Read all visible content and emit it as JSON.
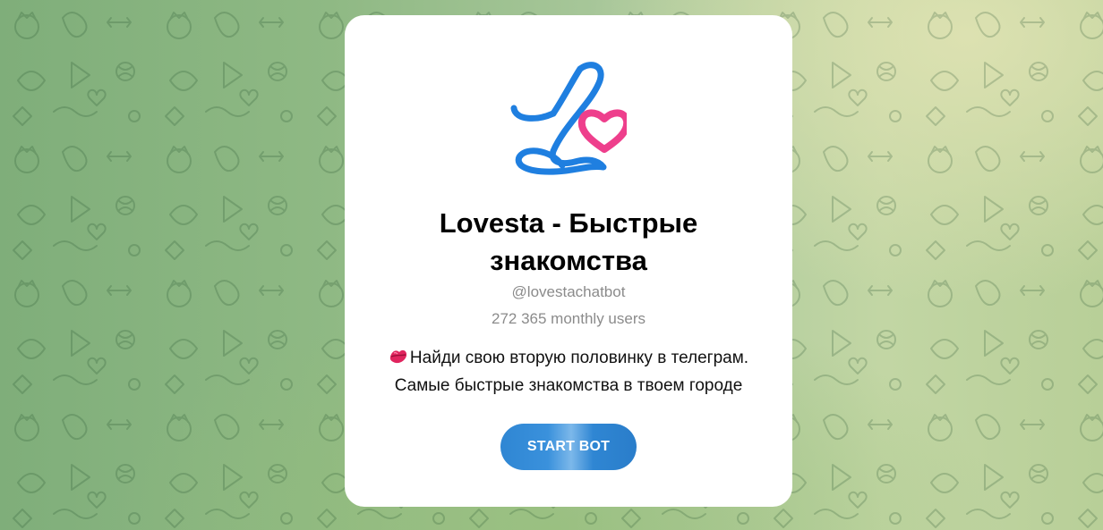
{
  "bot": {
    "title": "Lovesta - Быстрые знакомства",
    "username": "@lovestachatbot",
    "monthly_users": "272 365 monthly users",
    "description_line1": "Найди свою вторую половинку в телеграм.",
    "description_line2": "Самые быстрые знакомства в твоем городе",
    "description_icon": "kiss-mark-icon",
    "logo_icon": "lovesta-logo-icon"
  },
  "actions": {
    "start_label": "START BOT"
  },
  "colors": {
    "button": "#2f86d3",
    "logo_letter": "#1f7fe0",
    "logo_heart": "#ee3f8c",
    "muted_text": "#8b8b8b"
  }
}
